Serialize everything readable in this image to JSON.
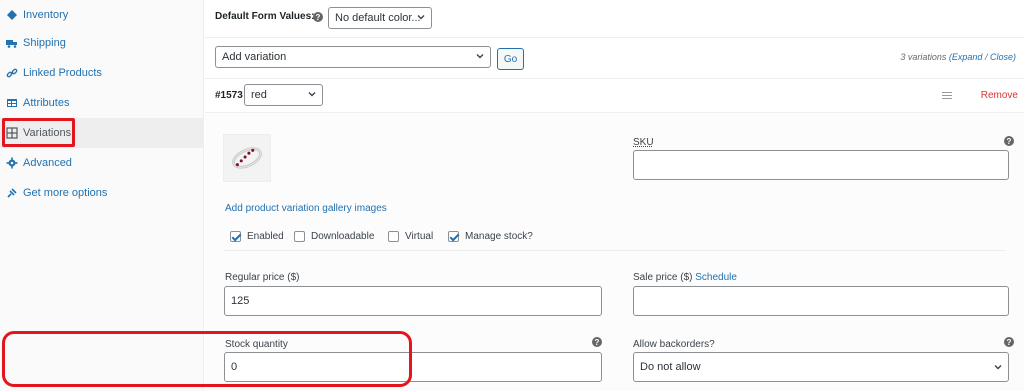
{
  "sidebar": {
    "items": [
      {
        "label": "Inventory",
        "icon": "diamond-icon"
      },
      {
        "label": "Shipping",
        "icon": "truck-icon"
      },
      {
        "label": "Linked Products",
        "icon": "link-icon"
      },
      {
        "label": "Attributes",
        "icon": "table-icon"
      },
      {
        "label": "Variations",
        "icon": "grid-icon"
      },
      {
        "label": "Advanced",
        "icon": "gear-icon"
      },
      {
        "label": "Get more options",
        "icon": "plugin-icon"
      }
    ]
  },
  "defaults": {
    "label": "Default Form Values:",
    "help": "?",
    "select_value": "No default color..."
  },
  "add_variation": {
    "select_value": "Add variation",
    "go_label": "Go",
    "count_text": "3 variations",
    "expand_label": "(Expand",
    "separator": "/",
    "close_label": "Close)"
  },
  "variation": {
    "id": "#1573",
    "attribute_value": "red",
    "remove_label": "Remove"
  },
  "panel": {
    "sku_label": "SKU",
    "sku_value": "",
    "gallery_link": "Add product variation gallery images",
    "checkboxes": [
      {
        "label": "Enabled",
        "checked": true
      },
      {
        "label": "Downloadable",
        "checked": false
      },
      {
        "label": "Virtual",
        "checked": false
      },
      {
        "label": "Manage stock?",
        "checked": true
      }
    ],
    "regular_price_label": "Regular price ($)",
    "regular_price_value": "125",
    "sale_price_label": "Sale price ($)",
    "schedule_link": "Schedule",
    "sale_price_value": "",
    "stock_qty_label": "Stock quantity",
    "stock_qty_value": "0",
    "backorders_label": "Allow backorders?",
    "backorders_value": "Do not allow"
  },
  "colors": {
    "highlight": "#e3161d",
    "link": "#2271b1",
    "remove": "#d63638"
  }
}
